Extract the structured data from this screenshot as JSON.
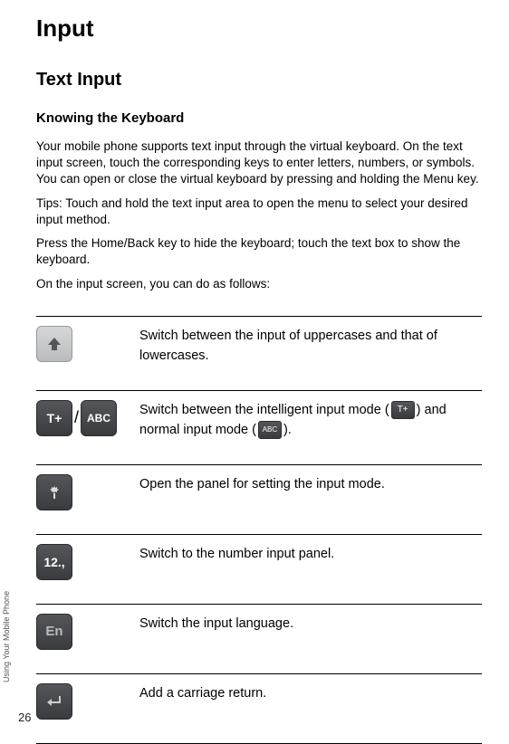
{
  "title": "Input",
  "section": "Text Input",
  "subsection": "Knowing the Keyboard",
  "paragraphs": {
    "p1": "Your mobile phone supports text input through the virtual keyboard. On the text input screen, touch the corresponding keys to enter letters, numbers, or symbols. You can open or close the virtual keyboard by pressing and holding the Menu key.",
    "p2": "Tips: Touch and hold the text input area to open the menu to select your desired input method.",
    "p3": "Press the Home/Back key to hide the keyboard; touch the text box to show the keyboard.",
    "p4": "On the input screen, you can do as follows:"
  },
  "rows": {
    "r1": {
      "desc": "Switch between the input of uppercases and that of lowercases."
    },
    "r2": {
      "desc_a": "Switch between the intelligent input mode (",
      "desc_b": ") and normal input mode (",
      "desc_c": ")."
    },
    "r3": {
      "desc": "Open the panel for setting the input mode."
    },
    "r4": {
      "desc": "Switch to the number input panel."
    },
    "r5": {
      "desc": "Switch the input language."
    },
    "r6": {
      "desc": "Add a carriage return."
    }
  },
  "icons": {
    "t_plus": "T+",
    "abc": "ABC",
    "num": "12.,",
    "en": "En"
  },
  "sideLabel": "Using Your Mobile Phone",
  "pageNumber": "26"
}
